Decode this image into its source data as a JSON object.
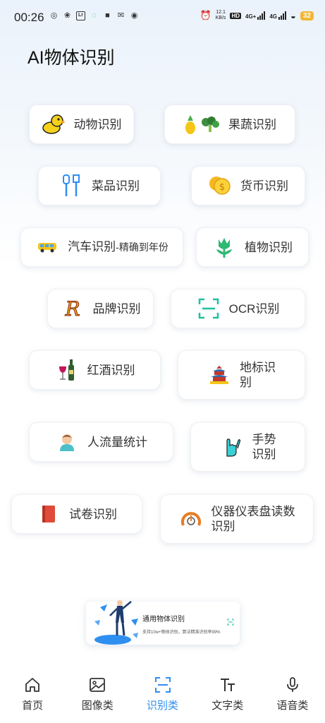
{
  "status": {
    "time": "00:26",
    "net_speed_top": "12.1",
    "net_speed_bottom": "KB/s",
    "hd": "HD",
    "net1": "4G+",
    "net2": "4G",
    "battery": "32",
    "lr": "Lr"
  },
  "page": {
    "title": "AI物体识别"
  },
  "cards": {
    "animal": "动物识别",
    "fruit": "果蔬识别",
    "dish": "菜品识别",
    "currency": "货币识别",
    "car": "汽车识别",
    "car_sub": "-精确到年份",
    "plant": "植物识别",
    "brand": "品牌识别",
    "ocr": "OCR识别",
    "wine": "红酒识别",
    "landmark_1": "地标识",
    "landmark_2": "别",
    "crowd": "人流量统计",
    "gesture_1": "手势",
    "gesture_2": "识别",
    "exam": "试卷识别",
    "meter_1": "仪器仪表盘读数",
    "meter_2": "识别"
  },
  "banner": {
    "title": "通用物体识别",
    "desc": "支持10w+物体识别，算法精准识别率99%"
  },
  "tabs": [
    "首页",
    "图像类",
    "识别类",
    "文字类",
    "语音类"
  ],
  "active_tab": "识别类",
  "colors": {
    "accent": "#2f8ff0",
    "ocr_green": "#1fbfa0",
    "battery": "#f2b632"
  }
}
